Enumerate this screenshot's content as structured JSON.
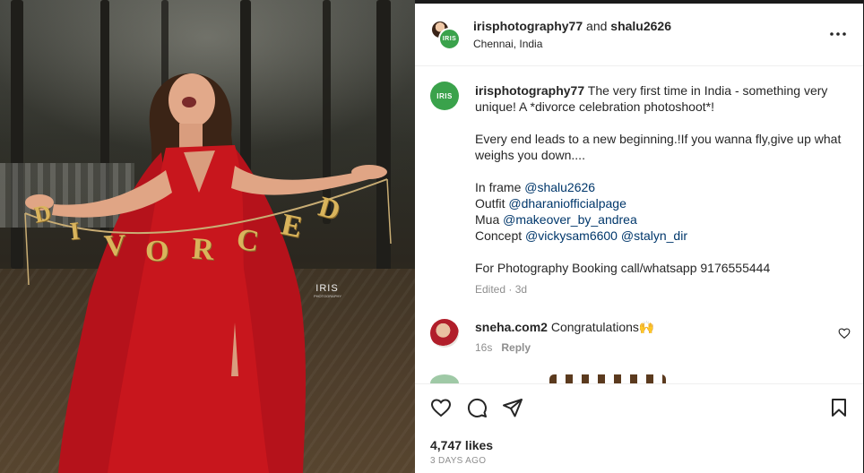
{
  "photo": {
    "watermark": "IRIS",
    "watermark_sub": "PHOTOGRAPHY",
    "banner_letters": [
      "D",
      "I",
      "V",
      "O",
      "R",
      "C",
      "E",
      "D"
    ]
  },
  "header": {
    "account1": "irisphotography77",
    "joiner": " and ",
    "account2": "shalu2626",
    "location": "Chennai, India",
    "avatar_text": "IRIS"
  },
  "caption": {
    "username": "irisphotography77",
    "line1": " The very first time in India - something very unique! A *divorce celebration photoshoot*!",
    "line2": "Every end leads to a new beginning.!If you wanna fly,give up what weighs you down....",
    "inframe_label": "In frame ",
    "inframe_link": "@shalu2626",
    "outfit_label": "Outfit ",
    "outfit_link": "@dharaniofficialpage",
    "mua_label": "Mua ",
    "mua_link": "@makeover_by_andrea",
    "concept_label": "Concept ",
    "concept_link1": "@vickysam6600",
    "concept_link2": "@stalyn_dir",
    "booking": "For Photography Booking call/whatsapp 9176555444",
    "meta": "Edited · 3d"
  },
  "comment": {
    "username": "sneha.com2",
    "text": " Congratulations🙌",
    "time": "16s",
    "reply": "Reply"
  },
  "footer": {
    "likes": "4,747 likes",
    "time_ago": "3 DAYS AGO"
  },
  "icons": {
    "like": "heart-icon",
    "comment": "comment-icon",
    "share": "share-icon",
    "save": "bookmark-icon",
    "options": "more-options-icon"
  },
  "colors": {
    "link": "#00376b",
    "dress": "#c8161d",
    "avatar_green": "#3aa24b"
  }
}
